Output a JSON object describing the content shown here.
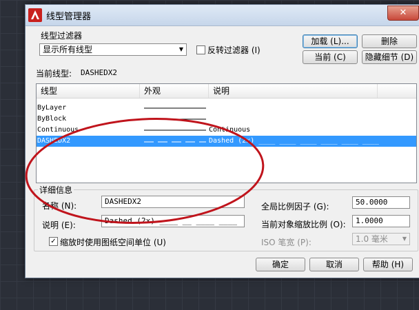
{
  "window": {
    "title": "线型管理器",
    "close_glyph": "✕"
  },
  "filter": {
    "group_label": "线型过滤器",
    "selected": "显示所有线型",
    "invert_label": "反转过滤器 (I)",
    "invert_checked": false
  },
  "buttons": {
    "load": "加载 (L)...",
    "delete": "删除",
    "current": "当前 (C)",
    "hide_details": "隐藏细节 (D)",
    "ok": "确定",
    "cancel": "取消",
    "help": "帮助 (H)"
  },
  "current_linetype": {
    "label": "当前线型:",
    "value": "DASHEDX2"
  },
  "list": {
    "columns": [
      "线型",
      "外观",
      "说明"
    ],
    "rows": [
      {
        "name": "ByLayer",
        "description": "",
        "selected": false
      },
      {
        "name": "ByBlock",
        "description": "",
        "selected": false
      },
      {
        "name": "Continuous",
        "description": "Continuous",
        "selected": false
      },
      {
        "name": "DASHEDX2",
        "description": "Dashed (2x) ____  ____  ____  ____  ____  ____",
        "selected": true
      }
    ]
  },
  "details": {
    "group_label": "详细信息",
    "name_label": "名称 (N):",
    "name_value": "DASHEDX2",
    "desc_label": "说明 (E):",
    "desc_value": "Dashed (2x) ____ __ ____ ____",
    "global_scale_label": "全局比例因子 (G):",
    "global_scale_value": "50.0000",
    "object_scale_label": "当前对象缩放比例 (O):",
    "object_scale_value": "1.0000",
    "pen_width_label": "ISO 笔宽 (P):",
    "pen_width_value": "1.0 毫米",
    "paper_space_label": "缩放时使用图纸空间单位 (U)",
    "paper_space_checked": true,
    "checkmark": "✓"
  },
  "annotation": {
    "color": "#c0141c"
  },
  "colors": {
    "selection": "#3399ff",
    "title_bar": "#c6d6ea"
  }
}
